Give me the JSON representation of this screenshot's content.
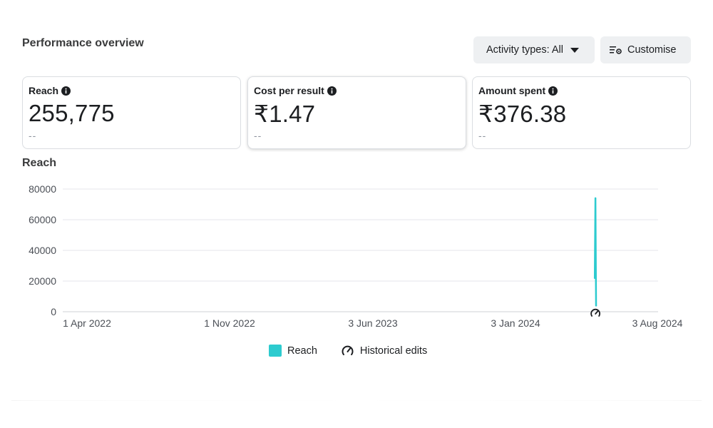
{
  "header": {
    "title": "Performance overview"
  },
  "toolbar": {
    "activity_label": "Activity types: All",
    "customise_label": "Customise"
  },
  "cards": [
    {
      "label": "Reach",
      "value": "255,775",
      "delta": "--"
    },
    {
      "label": "Cost per result",
      "value": "₹1.47",
      "delta": "--"
    },
    {
      "label": "Amount spent",
      "value": "₹376.38",
      "delta": "--"
    }
  ],
  "chart_title": "Reach",
  "chart_data": {
    "type": "line",
    "y_ticks": [
      0,
      20000,
      40000,
      60000,
      80000
    ],
    "ylim": [
      0,
      80000
    ],
    "x_ticks": [
      "1 Apr 2022",
      "1 Nov 2022",
      "3 Jun 2023",
      "3 Jan 2024",
      "3 Aug 2024"
    ],
    "x_tick_dates": [
      "2022-04-01",
      "2022-11-01",
      "2023-06-03",
      "2024-01-03",
      "2024-08-03"
    ],
    "series": [
      {
        "name": "Reach",
        "color": "#2dcbcf",
        "points": [
          {
            "date": "2024-05-01",
            "value": 22000
          },
          {
            "date": "2024-05-02",
            "value": 74000
          },
          {
            "date": "2024-05-03",
            "value": 4000
          }
        ]
      }
    ],
    "historical_edit_dates": [
      "2024-05-02"
    ],
    "grid": true
  },
  "legend": {
    "reach_label": "Reach",
    "historical_label": "Historical edits"
  },
  "colors": {
    "accent": "#2dcbcf",
    "button_bg": "#eef0f2",
    "border": "#dadde1"
  }
}
